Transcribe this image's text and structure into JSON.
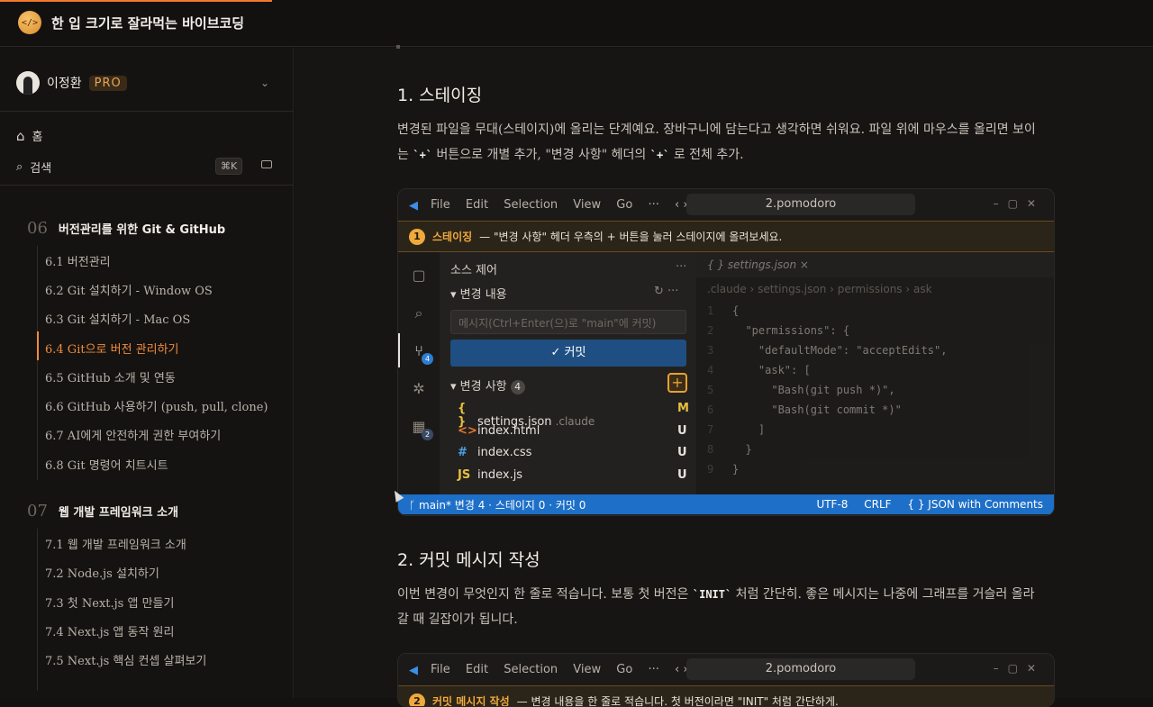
{
  "header": {
    "site_title": "한 입 크기로 잘라먹는 바이브코딩",
    "logo_glyph": "</>"
  },
  "sidebar": {
    "user_name": "이정환",
    "badge": "PRO",
    "home": "홈",
    "search": "검색",
    "search_shortcut": "⌘K",
    "sections": [
      {
        "num": "06",
        "title": "버전관리를 위한 Git & GitHub",
        "items": [
          "6.1 버전관리",
          "6.2 Git 설치하기 - Window OS",
          "6.3 Git 설치하기 - Mac OS",
          "6.4 Git으로 버전 관리하기",
          "6.5 GitHub 소개 및 연동",
          "6.6 GitHub 사용하기 (push, pull, clone)",
          "6.7 AI에게 안전하게 권한 부여하기",
          "6.8 Git 명령어 치트시트"
        ]
      },
      {
        "num": "07",
        "title": "웹 개발 프레임워크 소개",
        "items": [
          "7.1 웹 개발 프레임워크 소개",
          "7.2 Node.js 설치하기",
          "7.3 첫 Next.js 앱 만들기",
          "7.4 Next.js 앱 동작 원리",
          "7.5 Next.js 핵심 컨셉 살펴보기"
        ]
      }
    ],
    "accent": "#f08a3c"
  },
  "main": {
    "h1": "1. 스테이징",
    "p1_a": "변경된 파일을 무대(스테이지)에 올리는 단계예요. 장바구니에 담는다고 생각하면 쉬워요. 파일 위에 마우스를 올리면 보이는 ",
    "p1_code1": "`+`",
    "p1_b": " 버튼으로 개별 추가, \"변경 사항\" 헤더의 ",
    "p1_code2": "`+`",
    "p1_c": " 로 전체 추가.",
    "h2": "2. 커밋 메시지 작성",
    "p2_a": "이번 변경이 무엇인지 한 줄로 적습니다. 보통 첫 버전은 ",
    "p2_code": "`INIT`",
    "p2_b": " 처럼 간단히. 좋은 메시지는 나중에 그래프를 거슬러 올라갈 때 길잡이가 됩니다."
  },
  "ide": {
    "menu": [
      "File",
      "Edit",
      "Selection",
      "View",
      "Go",
      "···",
      "‹ ›"
    ],
    "window_title": "2.pomodoro",
    "banner_num": "1",
    "banner_key": "스테이징",
    "banner_text": "— \"변경 사항\" 헤더 우측의 + 버튼을 눌러 스테이지에 올려보세요.",
    "scm_title": "소스 제어",
    "changes_group": "변경 내용",
    "msg_placeholder": "메시지(Ctrl+Enter(으)로 \"main\"에 커밋)",
    "commit_label": "✓ 커밋",
    "changes_header": "변경 사항",
    "changes_count": "4",
    "scm_badge": "4",
    "ext_badge": "2",
    "files": [
      {
        "icon": "{ }",
        "name": "settings.json",
        "dir": ".claude",
        "status": "M",
        "color": "#e8c040"
      },
      {
        "icon": "<>",
        "name": "index.html",
        "dir": "",
        "status": "U",
        "color": "#e8772e"
      },
      {
        "icon": "#",
        "name": "index.css",
        "dir": "",
        "status": "U",
        "color": "#4aa0e8"
      },
      {
        "icon": "JS",
        "name": "index.js",
        "dir": "",
        "status": "U",
        "color": "#e8c040"
      }
    ],
    "editor_tab": "{ }  settings.json  ×",
    "breadcrumb": ".claude › settings.json › permissions › ask",
    "code_lines": [
      "{",
      "  \"permissions\": {",
      "    \"defaultMode\": \"acceptEdits\",",
      "    \"ask\": [",
      "      \"Bash(git push *)\",",
      "      \"Bash(git commit *)\"",
      "    ]",
      "  }",
      "}"
    ],
    "status_left": "ᚴ main*   변경 4 · 스테이지 0 · 커밋 0",
    "status_enc": "UTF-8",
    "status_eol": "CRLF",
    "status_lang": "{ } JSON with Comments",
    "banner2_key": "커밋 메시지 작성",
    "banner2_text": "— 변경 내용을 한 줄로 적습니다. 첫 버전이라면 \"INIT\" 처럼 간단하게."
  }
}
